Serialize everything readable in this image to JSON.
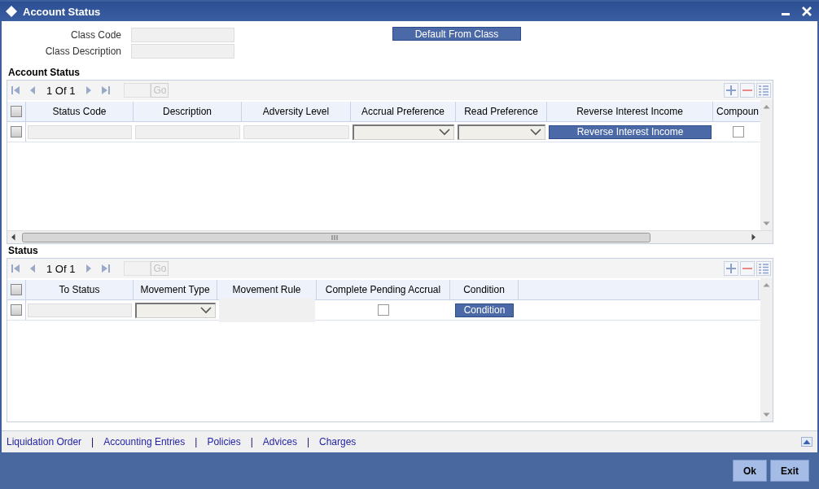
{
  "window": {
    "title": "Account Status"
  },
  "fields": [
    {
      "label": "Class Code"
    },
    {
      "label": "Class Description"
    }
  ],
  "default_button": "Default From Class",
  "sections": [
    {
      "title": "Account Status",
      "pager": "1 Of 1",
      "go": "Go",
      "header_checked": false,
      "columns": [
        "Status Code",
        "Description",
        "Adversity Level",
        "Accrual Preference",
        "Read Preference",
        "Reverse Interest Income",
        "Compoun"
      ],
      "rows": [
        {
          "checked": false,
          "cells": [
            {
              "kind": "text"
            },
            {
              "kind": "text"
            },
            {
              "kind": "text"
            },
            {
              "kind": "select"
            },
            {
              "kind": "select"
            },
            {
              "kind": "button",
              "label": "Reverse Interest Income"
            },
            {
              "kind": "checkbox",
              "checked": false
            }
          ]
        }
      ]
    },
    {
      "title": "Status",
      "pager": "1 Of 1",
      "go": "Go",
      "header_checked": false,
      "columns": [
        "To Status",
        "Movement Type",
        "Movement Rule",
        "Complete Pending Accrual",
        "Condition"
      ],
      "rows": [
        {
          "checked": false,
          "cells": [
            {
              "kind": "text"
            },
            {
              "kind": "select"
            },
            {
              "kind": "readonly"
            },
            {
              "kind": "checkbox",
              "checked": false
            },
            {
              "kind": "button",
              "label": "Condition"
            }
          ]
        }
      ]
    }
  ],
  "links": [
    {
      "kind": "link",
      "label": "Liquidation Order"
    },
    {
      "kind": "separator",
      "label": "|"
    },
    {
      "kind": "link",
      "label": "Accounting Entries"
    },
    {
      "kind": "separator",
      "label": "|"
    },
    {
      "kind": "link",
      "label": "Policies"
    },
    {
      "kind": "separator",
      "label": "|"
    },
    {
      "kind": "link",
      "label": "Advices"
    },
    {
      "kind": "separator",
      "label": "|"
    },
    {
      "kind": "link",
      "label": "Charges"
    }
  ],
  "buttons": [
    "Ok",
    "Exit"
  ]
}
